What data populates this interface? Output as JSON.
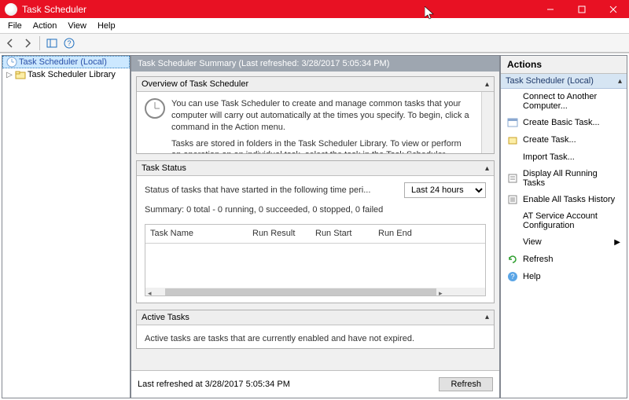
{
  "titlebar": {
    "title": "Task Scheduler"
  },
  "menu": [
    "File",
    "Action",
    "View",
    "Help"
  ],
  "tree": {
    "root": "Task Scheduler (Local)",
    "child": "Task Scheduler Library"
  },
  "center": {
    "header": "Task Scheduler Summary (Last refreshed: 3/28/2017 5:05:34 PM)",
    "overview": {
      "title": "Overview of Task Scheduler",
      "p1": "You can use Task Scheduler to create and manage common tasks that your computer will carry out automatically at the times you specify. To begin, click a command in the Action menu.",
      "p2": "Tasks are stored in folders in the Task Scheduler Library. To view or perform an operation on an individual task, select the task in the Task Scheduler Library and click on a command in the Action menu"
    },
    "status": {
      "title": "Task Status",
      "periodLabel": "Status of tasks that have started in the following time peri...",
      "periodValue": "Last 24 hours",
      "summary": "Summary: 0 total - 0 running, 0 succeeded, 0 stopped, 0 failed",
      "columns": [
        "Task Name",
        "Run Result",
        "Run Start",
        "Run End"
      ]
    },
    "active": {
      "title": "Active Tasks",
      "desc": "Active tasks are tasks that are currently enabled and have not expired."
    },
    "footer": {
      "lastRefreshed": "Last refreshed at 3/28/2017 5:05:34 PM",
      "refreshButton": "Refresh"
    }
  },
  "actions": {
    "title": "Actions",
    "subtitle": "Task Scheduler (Local)",
    "items": [
      {
        "label": "Connect to Another Computer...",
        "icon": null
      },
      {
        "label": "Create Basic Task...",
        "icon": "basic-task"
      },
      {
        "label": "Create Task...",
        "icon": "create-task"
      },
      {
        "label": "Import Task...",
        "icon": null
      },
      {
        "label": "Display All Running Tasks",
        "icon": "running"
      },
      {
        "label": "Enable All Tasks History",
        "icon": "history"
      },
      {
        "label": "AT Service Account Configuration",
        "icon": null
      },
      {
        "label": "View",
        "icon": null,
        "submenu": true
      },
      {
        "label": "Refresh",
        "icon": "refresh"
      },
      {
        "label": "Help",
        "icon": "help"
      }
    ]
  }
}
